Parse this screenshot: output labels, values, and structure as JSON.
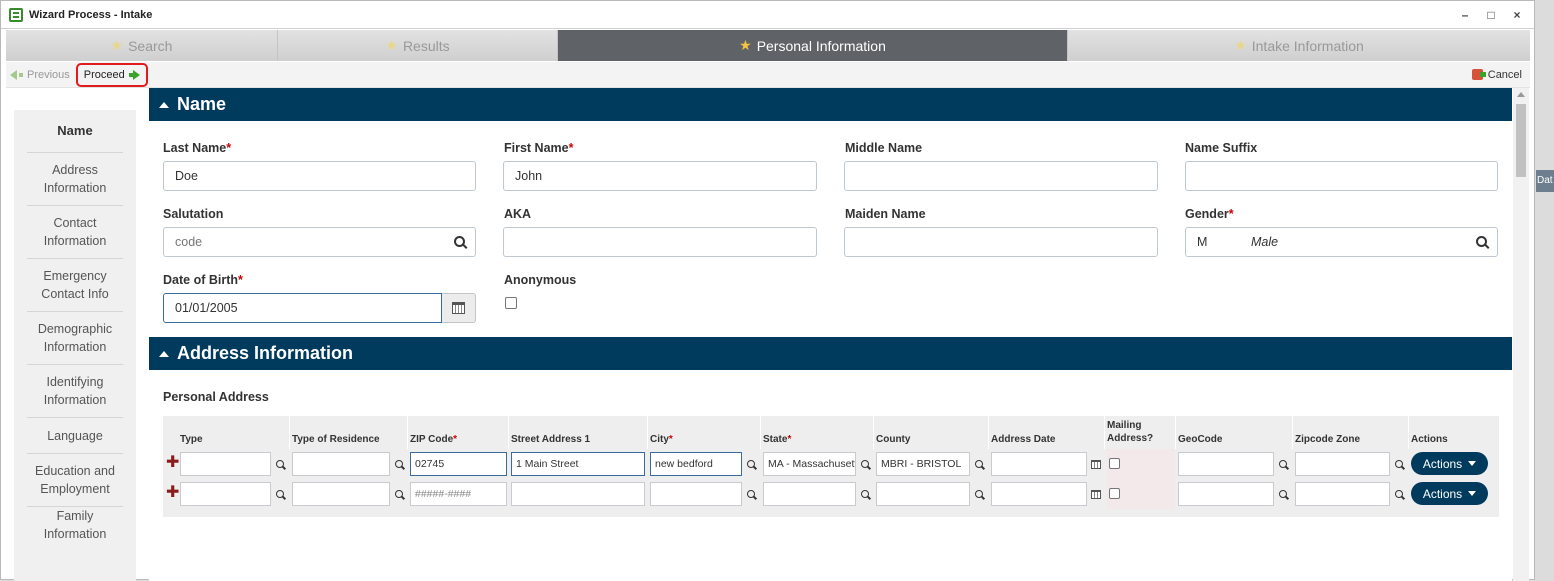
{
  "window": {
    "title": "Wizard Process - Intake",
    "controls": [
      "–",
      "□",
      "×"
    ]
  },
  "tabs": [
    {
      "label": "Search",
      "active": false
    },
    {
      "label": "Results",
      "active": false
    },
    {
      "label": "Personal Information",
      "active": true
    },
    {
      "label": "Intake Information",
      "active": false
    }
  ],
  "toolbar": {
    "previous": "Previous",
    "proceed": "Proceed",
    "cancel": "Cancel"
  },
  "sidebar": {
    "items": [
      {
        "label": "Name",
        "active": true
      },
      {
        "label": "Address Information"
      },
      {
        "label": "Contact Information"
      },
      {
        "label": "Emergency Contact Info"
      },
      {
        "label": "Demographic Information"
      },
      {
        "label": "Identifying Information"
      },
      {
        "label": "Language"
      },
      {
        "label": "Education and Employment"
      },
      {
        "label": "Family Information"
      }
    ]
  },
  "name_section": {
    "title": "Name",
    "last_name": {
      "label": "Last Name",
      "value": "Doe"
    },
    "first_name": {
      "label": "First Name",
      "value": "John"
    },
    "middle_name": {
      "label": "Middle Name",
      "value": ""
    },
    "name_suffix": {
      "label": "Name Suffix",
      "value": ""
    },
    "salutation": {
      "label": "Salutation",
      "placeholder": "code"
    },
    "aka": {
      "label": "AKA",
      "value": ""
    },
    "maiden_name": {
      "label": "Maiden Name",
      "value": ""
    },
    "gender": {
      "label": "Gender",
      "code": "M",
      "description": "Male"
    },
    "dob": {
      "label": "Date of Birth",
      "value": "01/01/2005"
    },
    "anonymous": {
      "label": "Anonymous",
      "checked": false
    },
    "required_mark": "*"
  },
  "address_section": {
    "title": "Address Information",
    "subtitle": "Personal Address",
    "columns": [
      "Type",
      "Type of Residence",
      "ZIP Code",
      "Street Address 1",
      "City",
      "State",
      "County",
      "Address Date",
      "Mailing Address?",
      "GeoCode",
      "Zipcode Zone",
      "Actions"
    ],
    "rows": [
      {
        "type": "",
        "residence": "",
        "zip": "02745",
        "street": "1 Main Street",
        "city": "new bedford",
        "state": "MA  - Massachusetts",
        "county": "MBRI      - BRISTOL",
        "date": "",
        "geocode": "",
        "zone": "",
        "action": "Actions"
      },
      {
        "type": "",
        "residence": "",
        "zip": "",
        "zip_placeholder": "#####-####",
        "street": "",
        "city": "",
        "state": "",
        "county": "",
        "date": "",
        "geocode": "",
        "zone": "",
        "action": "Actions"
      }
    ]
  },
  "right_strip": {
    "label": "Dat"
  }
}
